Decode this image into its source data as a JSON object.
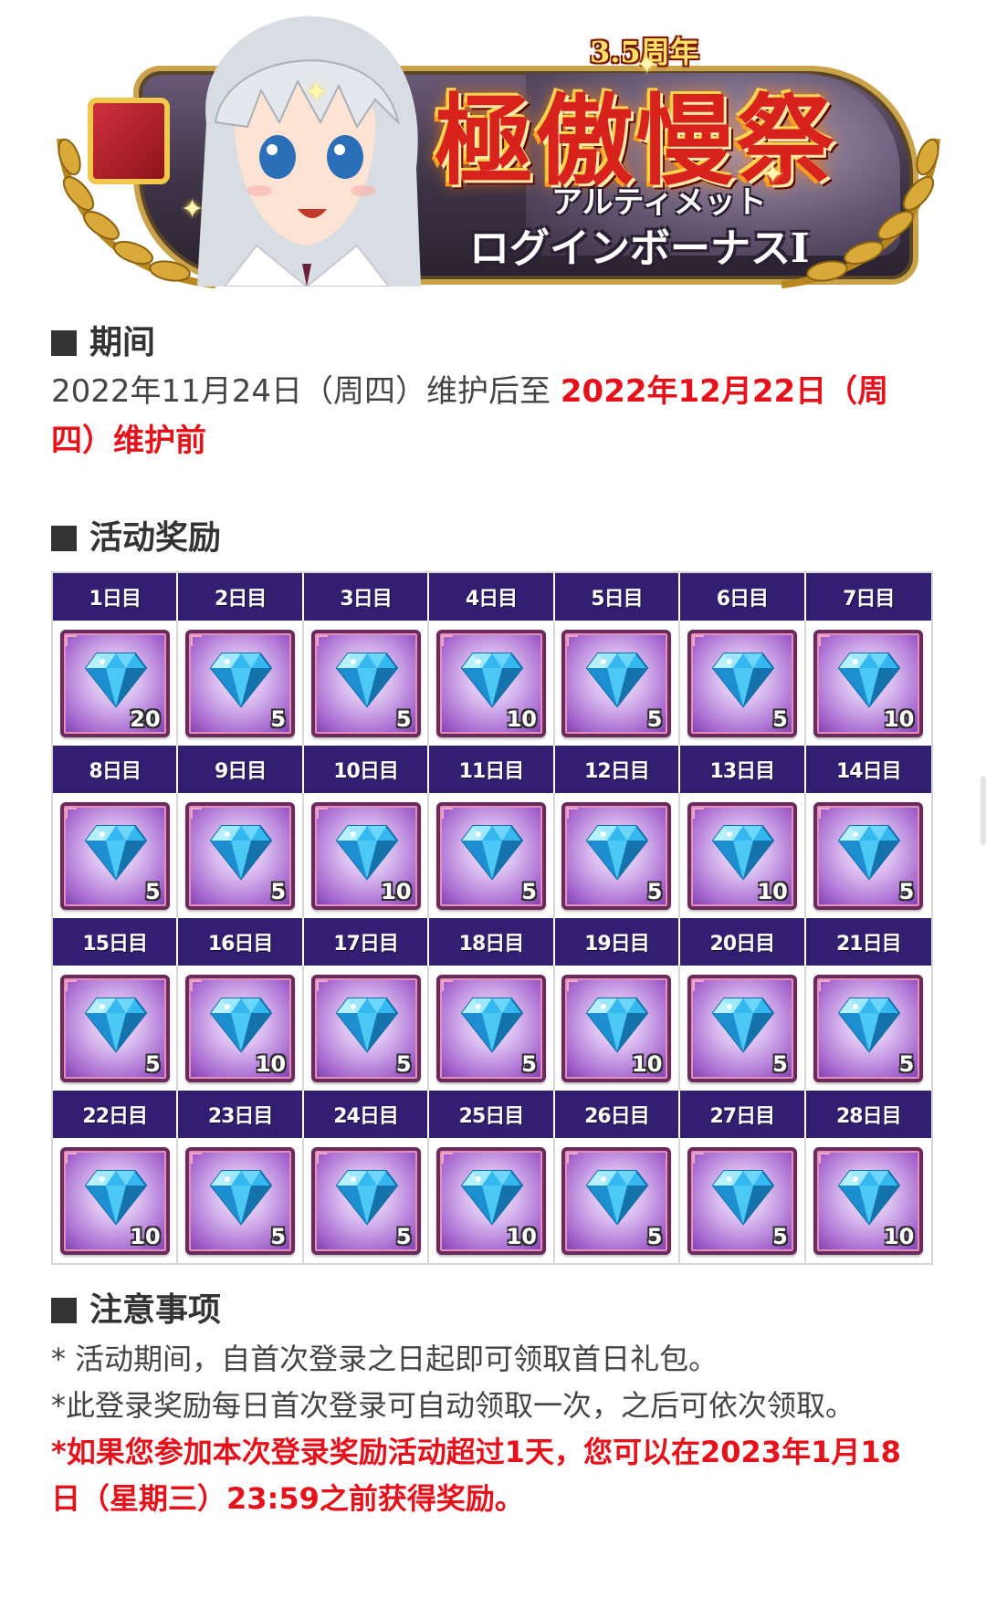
{
  "banner": {
    "anniversary": "3.5周年",
    "title": "極傲慢祭",
    "subtitle_line1": "アルティメット",
    "subtitle_line2": "ログインボーナスⅠ"
  },
  "period": {
    "heading": "期间",
    "start_text": "2022年11月24日（周四）维护后至 ",
    "end_text": "2022年12月22日（周四）维护前"
  },
  "rewards": {
    "heading": "活动奖励",
    "days": [
      {
        "label": "1日目",
        "qty": "20"
      },
      {
        "label": "2日目",
        "qty": "5"
      },
      {
        "label": "3日目",
        "qty": "5"
      },
      {
        "label": "4日目",
        "qty": "10"
      },
      {
        "label": "5日目",
        "qty": "5"
      },
      {
        "label": "6日目",
        "qty": "5"
      },
      {
        "label": "7日目",
        "qty": "10"
      },
      {
        "label": "8日目",
        "qty": "5"
      },
      {
        "label": "9日目",
        "qty": "5"
      },
      {
        "label": "10日目",
        "qty": "10"
      },
      {
        "label": "11日目",
        "qty": "5"
      },
      {
        "label": "12日目",
        "qty": "5"
      },
      {
        "label": "13日目",
        "qty": "10"
      },
      {
        "label": "14日目",
        "qty": "5"
      },
      {
        "label": "15日目",
        "qty": "5"
      },
      {
        "label": "16日目",
        "qty": "10"
      },
      {
        "label": "17日目",
        "qty": "5"
      },
      {
        "label": "18日目",
        "qty": "5"
      },
      {
        "label": "19日目",
        "qty": "10"
      },
      {
        "label": "20日目",
        "qty": "5"
      },
      {
        "label": "21日目",
        "qty": "5"
      },
      {
        "label": "22日目",
        "qty": "10"
      },
      {
        "label": "23日目",
        "qty": "5"
      },
      {
        "label": "24日目",
        "qty": "5"
      },
      {
        "label": "25日目",
        "qty": "10"
      },
      {
        "label": "26日目",
        "qty": "5"
      },
      {
        "label": "27日目",
        "qty": "5"
      },
      {
        "label": "28日目",
        "qty": "10"
      }
    ],
    "header_color": "#321f71",
    "item_icon": "blue-diamond-gem-icon"
  },
  "notes": {
    "heading": "注意事项",
    "line1": "* 活动期间，自首次登录之日起即可领取首日礼包。",
    "line2": "*此登录奖励每日首次登录可自动领取一次，之后可依次领取。",
    "line3": "*如果您参加本次登录奖励活动超过1天，您可以在2023年1月18日（星期三）23:59之前获得奖励。"
  },
  "colors": {
    "highlight": "#e5111b",
    "text": "#444444"
  }
}
